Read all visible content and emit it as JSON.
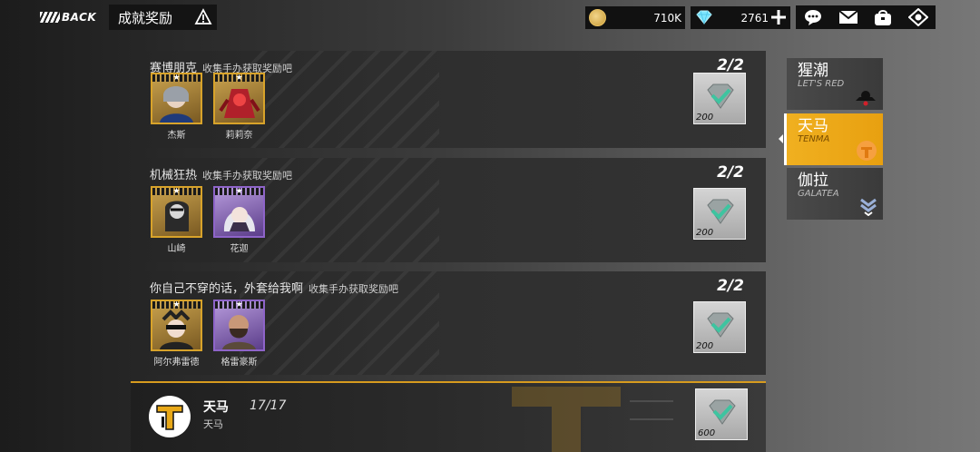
{
  "header": {
    "back_label": "BACK",
    "title": "成就奖励"
  },
  "resources": {
    "coins": "710K",
    "gems": "2761"
  },
  "achievements": [
    {
      "title": "赛博朋克",
      "subtitle": "收集手办获取奖励吧",
      "progress": "2/2",
      "reward_amount": "200",
      "characters": [
        {
          "name": "杰斯",
          "rarity": "gold"
        },
        {
          "name": "莉莉奈",
          "rarity": "gold"
        }
      ]
    },
    {
      "title": "机械狂热",
      "subtitle": "收集手办获取奖励吧",
      "progress": "2/2",
      "reward_amount": "200",
      "characters": [
        {
          "name": "山崎",
          "rarity": "gold"
        },
        {
          "name": "花迦",
          "rarity": "purple"
        }
      ]
    },
    {
      "title": "你自己不穿的话，外套给我啊",
      "subtitle": "收集手办获取奖励吧",
      "progress": "2/2",
      "reward_amount": "200",
      "characters": [
        {
          "name": "阿尔弗雷德",
          "rarity": "gold"
        },
        {
          "name": "格雷豪斯",
          "rarity": "purple"
        }
      ]
    }
  ],
  "final": {
    "name": "天马",
    "progress": "17/17",
    "subtitle": "天马",
    "reward_amount": "600"
  },
  "tabs": [
    {
      "cn": "猩潮",
      "en": "LET'S RED",
      "active": false
    },
    {
      "cn": "天马",
      "en": "TENMA",
      "active": true
    },
    {
      "cn": "伽拉",
      "en": "GALATEA",
      "active": false
    }
  ],
  "colors": {
    "accent": "#f0b020",
    "gold_frame": "#d8a32a",
    "purple_frame": "#8e64c9",
    "gem_check": "#3ec4a0"
  }
}
